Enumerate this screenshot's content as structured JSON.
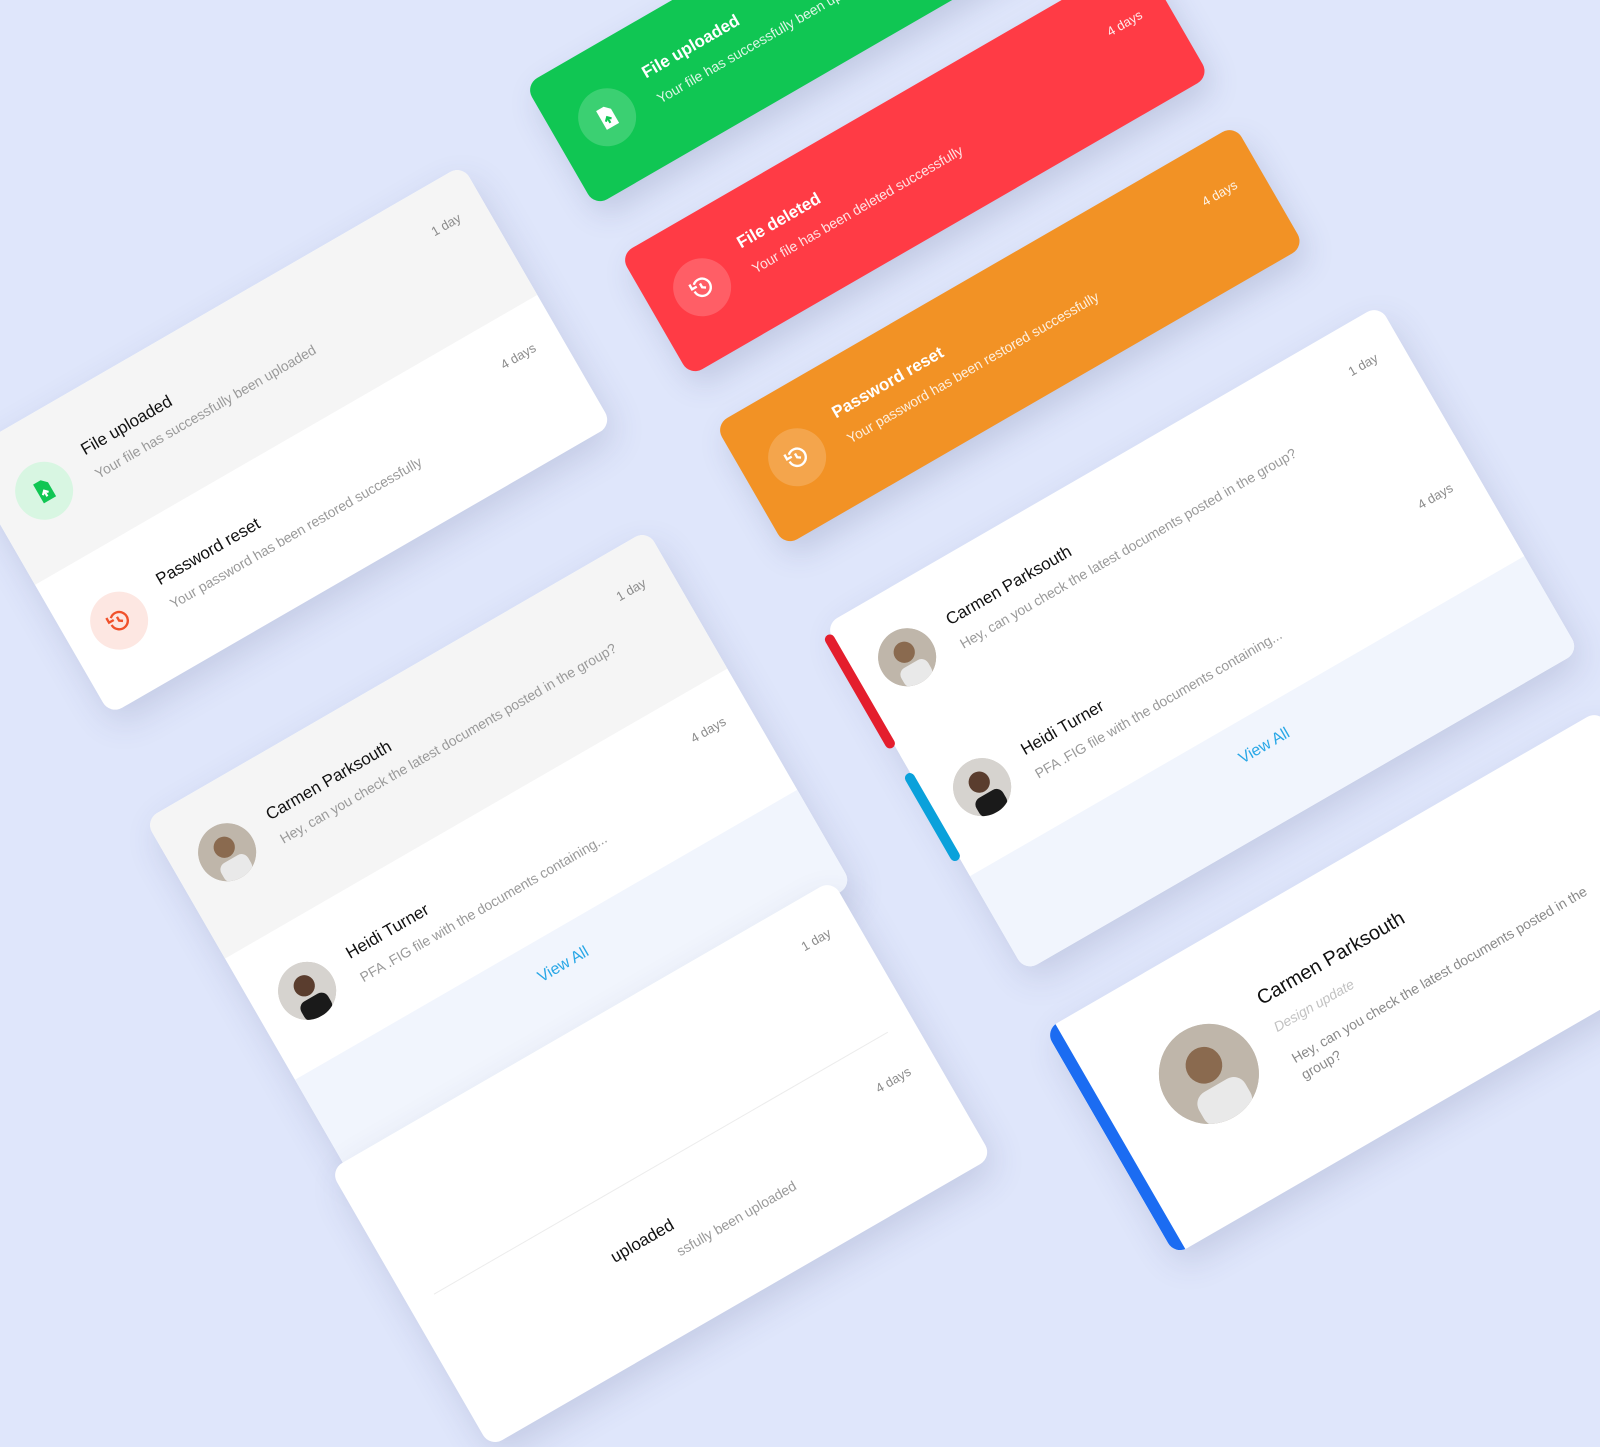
{
  "colors": {
    "background": "#dfe6fb",
    "success": "#10c653",
    "danger": "#ff3b45",
    "warning": "#f29225",
    "link": "#29a7e6",
    "accent_blue": "#1b6cf2",
    "accent_red": "#e41e2d",
    "accent_cyan": "#0aa1db"
  },
  "icons": {
    "upload": "file-upload-icon",
    "reset": "history-icon"
  },
  "notifications": {
    "upload": {
      "title": "File uploaded",
      "text": "Your file has successfully been uploaded",
      "time_1": "1 day",
      "time_4": "4 days"
    },
    "deleted": {
      "title": "File deleted",
      "text": "Your file has been deleted successfully",
      "time": "4 days"
    },
    "reset": {
      "title": "Password reset",
      "text": "Your password has been restored successfully",
      "time": "4 days"
    }
  },
  "messages": {
    "carmen": {
      "name": "Carmen Parksouth",
      "text": "Hey, can you check the latest documents posted in the group?",
      "role": "Design update",
      "time": "1 day"
    },
    "heidi": {
      "name": "Heidi Turner",
      "text": "PFA .FIG file with the documents containing...",
      "time": "4 days"
    },
    "view_all": "View All"
  },
  "partial": {
    "title": "uploaded",
    "text": "ssfully been uploaded",
    "time_1": "1 day",
    "time_4": "4 days"
  },
  "large_card": {
    "text_long": "Hey, can you check the latest documents posted in the group?"
  }
}
